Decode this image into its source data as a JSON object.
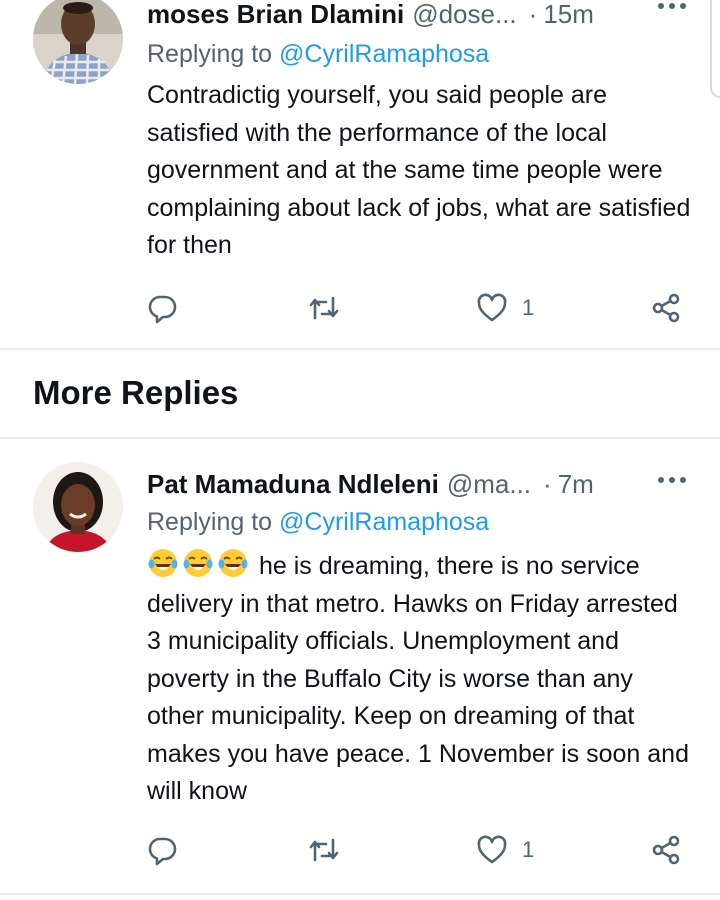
{
  "tweets": [
    {
      "display_name": "moses Brian Dlamini",
      "handle": "@dose...",
      "separator": "·",
      "time": "15m",
      "replying_prefix": "Replying to",
      "replying_to": "@CyrilRamaphosa",
      "text": "Contradictig yourself, you said people are satisfied with the performance of the local government and at the same time people were complaining about lack of jobs, what are satisfied for then",
      "like_count": "1"
    },
    {
      "display_name": "Pat Mamaduna Ndleleni",
      "handle": "@ma...",
      "separator": "·",
      "time": "7m",
      "replying_prefix": "Replying to",
      "replying_to": "@CyrilRamaphosa",
      "emojis": [
        "face-with-tears-of-joy",
        "face-with-tears-of-joy",
        "face-with-tears-of-joy"
      ],
      "text": "he is dreaming, there is no service delivery in that metro. Hawks on Friday arrested 3 municipality officials. Unemployment and poverty in the Buffalo City is worse than any other municipality. Keep on dreaming of that makes you have peace. 1 November is soon and will know",
      "like_count": "1"
    }
  ],
  "section": {
    "title": "More Replies"
  },
  "icons": {
    "more": "more-horizontal-icon",
    "reply": "reply-icon",
    "retweet": "retweet-icon",
    "like": "like-icon",
    "share": "share-icon"
  },
  "colors": {
    "text": "#0f1419",
    "secondary": "#536471",
    "link": "#1d9bf0",
    "divider": "#e6ecf0"
  }
}
